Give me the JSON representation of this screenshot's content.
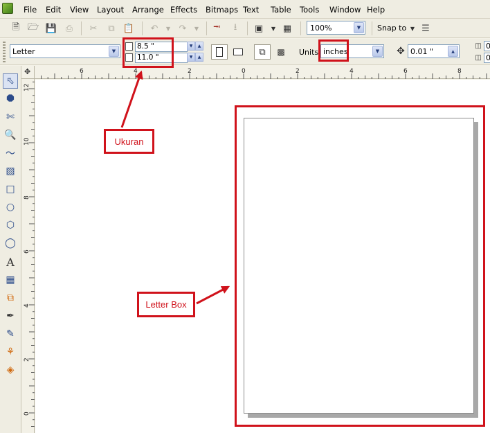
{
  "menu": [
    "File",
    "Edit",
    "View",
    "Layout",
    "Arrange",
    "Effects",
    "Bitmaps",
    "Text",
    "Table",
    "Tools",
    "Window",
    "Help"
  ],
  "toolbar": {
    "zoom": "100%",
    "snap_to": "Snap to"
  },
  "property_bar": {
    "paper_type": "Letter",
    "width": "8.5 \"",
    "height": "11.0 \"",
    "units_label": "Units:",
    "units": "inches",
    "nudge": "0.01 \"",
    "dup_x": "0",
    "dup_y": "0"
  },
  "ruler": {
    "horizontal": [
      "6",
      "4",
      "2",
      "0",
      "2",
      "4",
      "6",
      "8"
    ],
    "vertical": [
      "12",
      "10",
      "8",
      "6",
      "4",
      "2",
      "0"
    ]
  },
  "annotations": {
    "size_label": "Ukuran",
    "page_label": "Letter Box"
  },
  "colors": {
    "annotation": "#d0121b",
    "canvas": "#ffffff",
    "chrome": "#efede2"
  }
}
